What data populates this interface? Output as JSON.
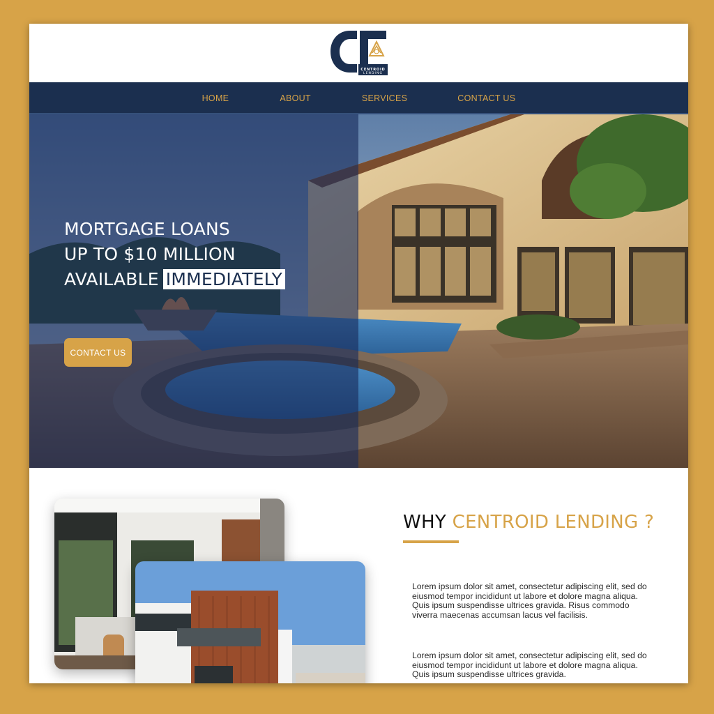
{
  "logo": {
    "name": "CENTROID",
    "sub": "LENDING"
  },
  "nav": {
    "items": [
      {
        "label": "HOME"
      },
      {
        "label": "ABOUT"
      },
      {
        "label": "SERVICES"
      },
      {
        "label": "CONTACT US"
      }
    ]
  },
  "hero": {
    "line1": "MORTGAGE LOANS",
    "line2": "UP TO $10 MILLION",
    "line3": "AVAILABLE",
    "highlight": "IMMEDIATELY",
    "cta": "CONTACT US"
  },
  "why": {
    "title_plain": "WHY ",
    "title_accent": "CENTROID LENDING ?",
    "para1": "Lorem ipsum dolor sit amet, consectetur adipiscing elit, sed do eiusmod tempor incididunt ut labore et dolore magna aliqua. Quis ipsum suspendisse ultrices gravida. Risus commodo viverra maecenas accumsan lacus vel facilisis.",
    "para2": "Lorem ipsum dolor sit amet, consectetur adipiscing elit, sed do eiusmod tempor incididunt ut labore et dolore magna aliqua. Quis ipsum suspendisse ultrices gravida."
  },
  "colors": {
    "frame": "#d7a348",
    "navy": "#1b2f4f",
    "gold": "#d7a348",
    "overlay": "#182c5c"
  }
}
